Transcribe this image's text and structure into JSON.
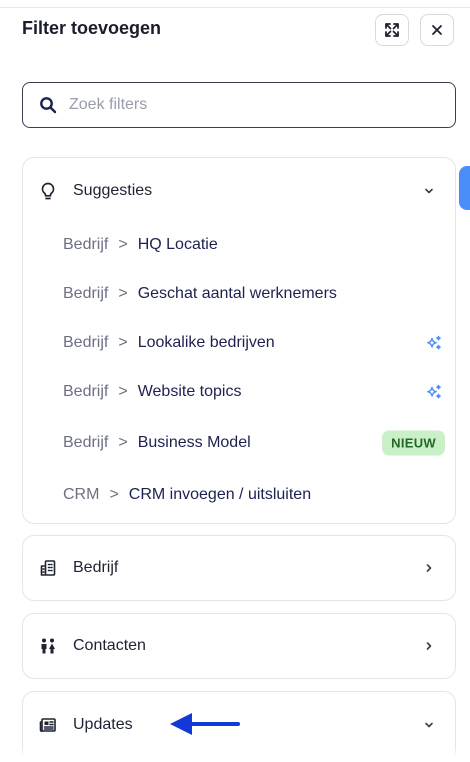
{
  "header": {
    "title": "Filter toevoegen",
    "expand_icon": "expand-icon",
    "close_icon": "close-icon"
  },
  "search": {
    "placeholder": "Zoek filters",
    "value": ""
  },
  "suggestions": {
    "title": "Suggesties",
    "icon": "lightbulb-icon",
    "items": [
      {
        "category": "Bedrijf",
        "separator": ">",
        "name": "HQ Locatie"
      },
      {
        "category": "Bedrijf",
        "separator": ">",
        "name": "Geschat aantal werknemers"
      },
      {
        "category": "Bedrijf",
        "separator": ">",
        "name": "Lookalike bedrijven",
        "icon": "sparkle-icon"
      },
      {
        "category": "Bedrijf",
        "separator": ">",
        "name": "Website topics",
        "icon": "sparkle-icon"
      },
      {
        "category": "Bedrijf",
        "separator": ">",
        "name": "Business Model",
        "badge": "NIEUW"
      },
      {
        "category": "CRM",
        "separator": ">",
        "name": "CRM invoegen / uitsluiten"
      }
    ]
  },
  "sections": [
    {
      "label": "Bedrijf",
      "icon": "building-icon",
      "state": "collapsed"
    },
    {
      "label": "Contacten",
      "icon": "people-icon",
      "state": "collapsed"
    },
    {
      "label": "Updates",
      "icon": "newspaper-icon",
      "state": "expanded"
    }
  ],
  "colors": {
    "accent": "#4b8df8",
    "sparkle": "#4f8ef7",
    "badge_bg": "#c9f0c7",
    "badge_text": "#23682a",
    "arrow": "#1438d6"
  }
}
